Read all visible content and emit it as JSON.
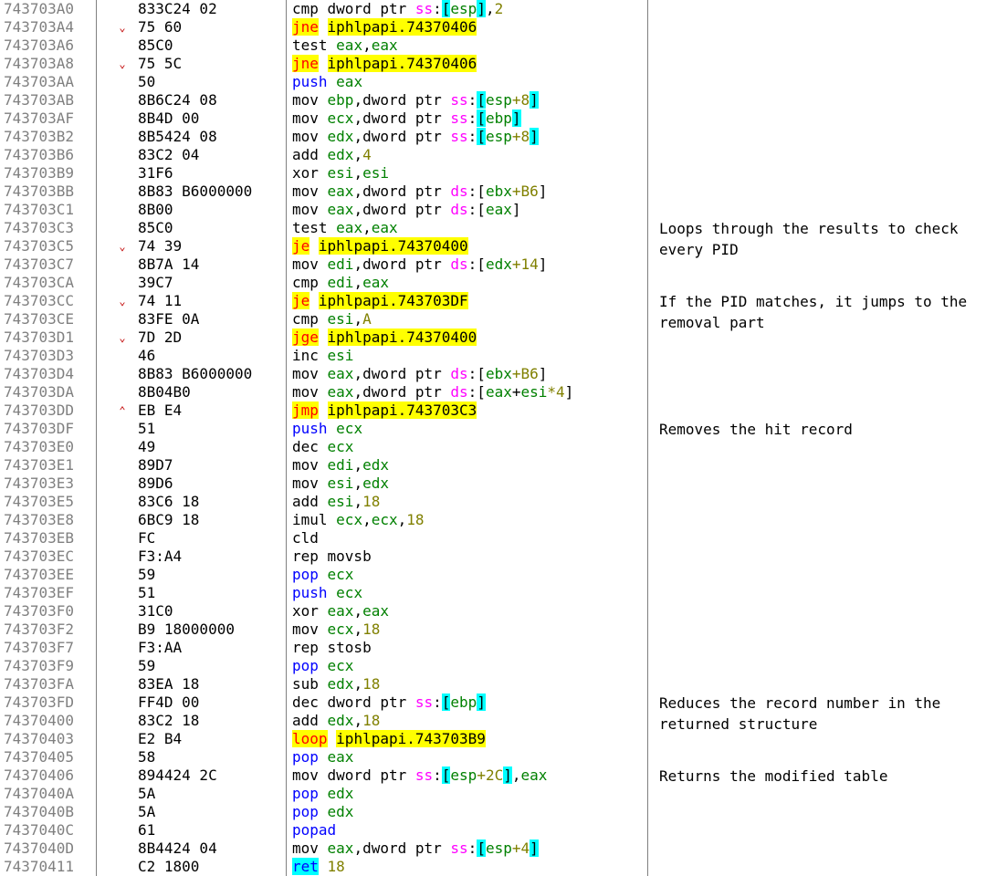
{
  "colors": {
    "address": "#808080",
    "mnemonic_jump": "#ff0000",
    "mnemonic_push_pop": "#0000ff",
    "register": "#008000",
    "number": "#808000",
    "segment": "#ff00ff",
    "highlight_jump": "#ffff00",
    "highlight_ret": "#00ffff",
    "bracket": "#00ffff"
  },
  "rows": [
    {
      "addr": "743703A0",
      "arrow": "",
      "bytes": "833C24 02",
      "tokens": [
        {
          "t": "cmp dword ptr "
        },
        {
          "t": "ss",
          "c": "seg"
        },
        {
          "t": ":"
        },
        {
          "t": "[",
          "c": "br"
        },
        {
          "t": "esp",
          "c": "reg"
        },
        {
          "t": "]",
          "c": "br"
        },
        {
          "t": ","
        },
        {
          "t": "2",
          "c": "num"
        }
      ]
    },
    {
      "addr": "743703A4",
      "arrow": "⌄",
      "bytes": "75 60",
      "tokens": [
        {
          "t": "jne",
          "c": "jmp",
          "hl": true
        },
        {
          "t": " "
        },
        {
          "t": "iphlpapi.74370406",
          "hl": true
        }
      ]
    },
    {
      "addr": "743703A6",
      "arrow": "",
      "bytes": "85C0",
      "tokens": [
        {
          "t": "test "
        },
        {
          "t": "eax",
          "c": "reg"
        },
        {
          "t": ","
        },
        {
          "t": "eax",
          "c": "reg"
        }
      ]
    },
    {
      "addr": "743703A8",
      "arrow": "⌄",
      "bytes": "75 5C",
      "tokens": [
        {
          "t": "jne",
          "c": "jmp",
          "hl": true
        },
        {
          "t": " "
        },
        {
          "t": "iphlpapi.74370406",
          "hl": true
        }
      ]
    },
    {
      "addr": "743703AA",
      "arrow": "",
      "bytes": "50",
      "tokens": [
        {
          "t": "push ",
          "c": "stk"
        },
        {
          "t": "eax",
          "c": "reg"
        }
      ]
    },
    {
      "addr": "743703AB",
      "arrow": "",
      "bytes": "8B6C24 08",
      "tokens": [
        {
          "t": "mov "
        },
        {
          "t": "ebp",
          "c": "reg"
        },
        {
          "t": ",dword ptr "
        },
        {
          "t": "ss",
          "c": "seg"
        },
        {
          "t": ":"
        },
        {
          "t": "[",
          "c": "br"
        },
        {
          "t": "esp",
          "c": "reg"
        },
        {
          "t": "+8",
          "c": "num"
        },
        {
          "t": "]",
          "c": "br"
        }
      ]
    },
    {
      "addr": "743703AF",
      "arrow": "",
      "bytes": "8B4D 00",
      "tokens": [
        {
          "t": "mov "
        },
        {
          "t": "ecx",
          "c": "reg"
        },
        {
          "t": ",dword ptr "
        },
        {
          "t": "ss",
          "c": "seg"
        },
        {
          "t": ":"
        },
        {
          "t": "[",
          "c": "br"
        },
        {
          "t": "ebp",
          "c": "reg"
        },
        {
          "t": "]",
          "c": "br"
        }
      ]
    },
    {
      "addr": "743703B2",
      "arrow": "",
      "bytes": "8B5424 08",
      "tokens": [
        {
          "t": "mov "
        },
        {
          "t": "edx",
          "c": "reg"
        },
        {
          "t": ",dword ptr "
        },
        {
          "t": "ss",
          "c": "seg"
        },
        {
          "t": ":"
        },
        {
          "t": "[",
          "c": "br"
        },
        {
          "t": "esp",
          "c": "reg"
        },
        {
          "t": "+8",
          "c": "num"
        },
        {
          "t": "]",
          "c": "br"
        }
      ]
    },
    {
      "addr": "743703B6",
      "arrow": "",
      "bytes": "83C2 04",
      "tokens": [
        {
          "t": "add "
        },
        {
          "t": "edx",
          "c": "reg"
        },
        {
          "t": ","
        },
        {
          "t": "4",
          "c": "num"
        }
      ]
    },
    {
      "addr": "743703B9",
      "arrow": "",
      "bytes": "31F6",
      "tokens": [
        {
          "t": "xor "
        },
        {
          "t": "esi",
          "c": "reg"
        },
        {
          "t": ","
        },
        {
          "t": "esi",
          "c": "reg"
        }
      ]
    },
    {
      "addr": "743703BB",
      "arrow": "",
      "bytes": "8B83 B6000000",
      "tokens": [
        {
          "t": "mov "
        },
        {
          "t": "eax",
          "c": "reg"
        },
        {
          "t": ",dword ptr "
        },
        {
          "t": "ds",
          "c": "seg"
        },
        {
          "t": ":["
        },
        {
          "t": "ebx",
          "c": "reg"
        },
        {
          "t": "+B6",
          "c": "num"
        },
        {
          "t": "]"
        }
      ]
    },
    {
      "addr": "743703C1",
      "arrow": "",
      "bytes": "8B00",
      "tokens": [
        {
          "t": "mov "
        },
        {
          "t": "eax",
          "c": "reg"
        },
        {
          "t": ",dword ptr "
        },
        {
          "t": "ds",
          "c": "seg"
        },
        {
          "t": ":["
        },
        {
          "t": "eax",
          "c": "reg"
        },
        {
          "t": "]"
        }
      ]
    },
    {
      "addr": "743703C3",
      "arrow": "",
      "bytes": "85C0",
      "tokens": [
        {
          "t": "test "
        },
        {
          "t": "eax",
          "c": "reg"
        },
        {
          "t": ","
        },
        {
          "t": "eax",
          "c": "reg"
        }
      ]
    },
    {
      "addr": "743703C5",
      "arrow": "⌄",
      "bytes": "74 39",
      "tokens": [
        {
          "t": "je",
          "c": "jmp",
          "hl": true
        },
        {
          "t": " "
        },
        {
          "t": "iphlpapi.74370400",
          "hl": true
        }
      ]
    },
    {
      "addr": "743703C7",
      "arrow": "",
      "bytes": "8B7A 14",
      "tokens": [
        {
          "t": "mov "
        },
        {
          "t": "edi",
          "c": "reg"
        },
        {
          "t": ",dword ptr "
        },
        {
          "t": "ds",
          "c": "seg"
        },
        {
          "t": ":["
        },
        {
          "t": "edx",
          "c": "reg"
        },
        {
          "t": "+14",
          "c": "num"
        },
        {
          "t": "]"
        }
      ]
    },
    {
      "addr": "743703CA",
      "arrow": "",
      "bytes": "39C7",
      "tokens": [
        {
          "t": "cmp "
        },
        {
          "t": "edi",
          "c": "reg"
        },
        {
          "t": ","
        },
        {
          "t": "eax",
          "c": "reg"
        }
      ]
    },
    {
      "addr": "743703CC",
      "arrow": "⌄",
      "bytes": "74 11",
      "tokens": [
        {
          "t": "je",
          "c": "jmp",
          "hl": true
        },
        {
          "t": " "
        },
        {
          "t": "iphlpapi.743703DF",
          "hl": true
        }
      ]
    },
    {
      "addr": "743703CE",
      "arrow": "",
      "bytes": "83FE 0A",
      "tokens": [
        {
          "t": "cmp "
        },
        {
          "t": "esi",
          "c": "reg"
        },
        {
          "t": ","
        },
        {
          "t": "A",
          "c": "num"
        }
      ]
    },
    {
      "addr": "743703D1",
      "arrow": "⌄",
      "bytes": "7D 2D",
      "tokens": [
        {
          "t": "jge",
          "c": "jmp",
          "hl": true
        },
        {
          "t": " "
        },
        {
          "t": "iphlpapi.74370400",
          "hl": true
        }
      ]
    },
    {
      "addr": "743703D3",
      "arrow": "",
      "bytes": "46",
      "tokens": [
        {
          "t": "inc "
        },
        {
          "t": "esi",
          "c": "reg"
        }
      ]
    },
    {
      "addr": "743703D4",
      "arrow": "",
      "bytes": "8B83 B6000000",
      "tokens": [
        {
          "t": "mov "
        },
        {
          "t": "eax",
          "c": "reg"
        },
        {
          "t": ",dword ptr "
        },
        {
          "t": "ds",
          "c": "seg"
        },
        {
          "t": ":["
        },
        {
          "t": "ebx",
          "c": "reg"
        },
        {
          "t": "+B6",
          "c": "num"
        },
        {
          "t": "]"
        }
      ]
    },
    {
      "addr": "743703DA",
      "arrow": "",
      "bytes": "8B04B0",
      "tokens": [
        {
          "t": "mov "
        },
        {
          "t": "eax",
          "c": "reg"
        },
        {
          "t": ",dword ptr "
        },
        {
          "t": "ds",
          "c": "seg"
        },
        {
          "t": ":["
        },
        {
          "t": "eax",
          "c": "reg"
        },
        {
          "t": "+"
        },
        {
          "t": "esi",
          "c": "reg"
        },
        {
          "t": "*4",
          "c": "num"
        },
        {
          "t": "]"
        }
      ]
    },
    {
      "addr": "743703DD",
      "arrow": "⌃",
      "bytes": "EB E4",
      "tokens": [
        {
          "t": "jmp",
          "c": "jmp",
          "hl": true
        },
        {
          "t": " "
        },
        {
          "t": "iphlpapi.743703C3",
          "hl": true
        }
      ]
    },
    {
      "addr": "743703DF",
      "arrow": "",
      "bytes": "51",
      "tokens": [
        {
          "t": "push ",
          "c": "stk"
        },
        {
          "t": "ecx",
          "c": "reg"
        }
      ]
    },
    {
      "addr": "743703E0",
      "arrow": "",
      "bytes": "49",
      "tokens": [
        {
          "t": "dec "
        },
        {
          "t": "ecx",
          "c": "reg"
        }
      ]
    },
    {
      "addr": "743703E1",
      "arrow": "",
      "bytes": "89D7",
      "tokens": [
        {
          "t": "mov "
        },
        {
          "t": "edi",
          "c": "reg"
        },
        {
          "t": ","
        },
        {
          "t": "edx",
          "c": "reg"
        }
      ]
    },
    {
      "addr": "743703E3",
      "arrow": "",
      "bytes": "89D6",
      "tokens": [
        {
          "t": "mov "
        },
        {
          "t": "esi",
          "c": "reg"
        },
        {
          "t": ","
        },
        {
          "t": "edx",
          "c": "reg"
        }
      ]
    },
    {
      "addr": "743703E5",
      "arrow": "",
      "bytes": "83C6 18",
      "tokens": [
        {
          "t": "add "
        },
        {
          "t": "esi",
          "c": "reg"
        },
        {
          "t": ","
        },
        {
          "t": "18",
          "c": "num"
        }
      ]
    },
    {
      "addr": "743703E8",
      "arrow": "",
      "bytes": "6BC9 18",
      "tokens": [
        {
          "t": "imul "
        },
        {
          "t": "ecx",
          "c": "reg"
        },
        {
          "t": ","
        },
        {
          "t": "ecx",
          "c": "reg"
        },
        {
          "t": ","
        },
        {
          "t": "18",
          "c": "num"
        }
      ]
    },
    {
      "addr": "743703EB",
      "arrow": "",
      "bytes": "FC",
      "tokens": [
        {
          "t": "cld"
        }
      ]
    },
    {
      "addr": "743703EC",
      "arrow": "",
      "bytes": "F3:A4",
      "tokens": [
        {
          "t": "rep movsb"
        }
      ]
    },
    {
      "addr": "743703EE",
      "arrow": "",
      "bytes": "59",
      "tokens": [
        {
          "t": "pop ",
          "c": "stk"
        },
        {
          "t": "ecx",
          "c": "reg"
        }
      ]
    },
    {
      "addr": "743703EF",
      "arrow": "",
      "bytes": "51",
      "tokens": [
        {
          "t": "push ",
          "c": "stk"
        },
        {
          "t": "ecx",
          "c": "reg"
        }
      ]
    },
    {
      "addr": "743703F0",
      "arrow": "",
      "bytes": "31C0",
      "tokens": [
        {
          "t": "xor "
        },
        {
          "t": "eax",
          "c": "reg"
        },
        {
          "t": ","
        },
        {
          "t": "eax",
          "c": "reg"
        }
      ]
    },
    {
      "addr": "743703F2",
      "arrow": "",
      "bytes": "B9 18000000",
      "tokens": [
        {
          "t": "mov "
        },
        {
          "t": "ecx",
          "c": "reg"
        },
        {
          "t": ","
        },
        {
          "t": "18",
          "c": "num"
        }
      ]
    },
    {
      "addr": "743703F7",
      "arrow": "",
      "bytes": "F3:AA",
      "tokens": [
        {
          "t": "rep stosb"
        }
      ]
    },
    {
      "addr": "743703F9",
      "arrow": "",
      "bytes": "59",
      "tokens": [
        {
          "t": "pop ",
          "c": "stk"
        },
        {
          "t": "ecx",
          "c": "reg"
        }
      ]
    },
    {
      "addr": "743703FA",
      "arrow": "",
      "bytes": "83EA 18",
      "tokens": [
        {
          "t": "sub "
        },
        {
          "t": "edx",
          "c": "reg"
        },
        {
          "t": ","
        },
        {
          "t": "18",
          "c": "num"
        }
      ]
    },
    {
      "addr": "743703FD",
      "arrow": "",
      "bytes": "FF4D 00",
      "tokens": [
        {
          "t": "dec dword ptr "
        },
        {
          "t": "ss",
          "c": "seg"
        },
        {
          "t": ":"
        },
        {
          "t": "[",
          "c": "br"
        },
        {
          "t": "ebp",
          "c": "reg"
        },
        {
          "t": "]",
          "c": "br"
        }
      ]
    },
    {
      "addr": "74370400",
      "arrow": "",
      "bytes": "83C2 18",
      "tokens": [
        {
          "t": "add "
        },
        {
          "t": "edx",
          "c": "reg"
        },
        {
          "t": ","
        },
        {
          "t": "18",
          "c": "num"
        }
      ]
    },
    {
      "addr": "74370403",
      "arrow": "",
      "bytes": "E2 B4",
      "tokens": [
        {
          "t": "loop",
          "c": "jmp",
          "hl": true
        },
        {
          "t": " "
        },
        {
          "t": "iphlpapi.743703B9",
          "hl": true
        }
      ]
    },
    {
      "addr": "74370405",
      "arrow": "",
      "bytes": "58",
      "tokens": [
        {
          "t": "pop ",
          "c": "stk"
        },
        {
          "t": "eax",
          "c": "reg"
        }
      ]
    },
    {
      "addr": "74370406",
      "arrow": "",
      "bytes": "894424 2C",
      "tokens": [
        {
          "t": "mov dword ptr "
        },
        {
          "t": "ss",
          "c": "seg"
        },
        {
          "t": ":"
        },
        {
          "t": "[",
          "c": "br"
        },
        {
          "t": "esp",
          "c": "reg"
        },
        {
          "t": "+2C",
          "c": "num"
        },
        {
          "t": "]",
          "c": "br"
        },
        {
          "t": ","
        },
        {
          "t": "eax",
          "c": "reg"
        }
      ]
    },
    {
      "addr": "7437040A",
      "arrow": "",
      "bytes": "5A",
      "tokens": [
        {
          "t": "pop ",
          "c": "stk"
        },
        {
          "t": "edx",
          "c": "reg"
        }
      ]
    },
    {
      "addr": "7437040B",
      "arrow": "",
      "bytes": "5A",
      "tokens": [
        {
          "t": "pop ",
          "c": "stk"
        },
        {
          "t": "edx",
          "c": "reg"
        }
      ]
    },
    {
      "addr": "7437040C",
      "arrow": "",
      "bytes": "61",
      "tokens": [
        {
          "t": "popad",
          "c": "stk"
        }
      ]
    },
    {
      "addr": "7437040D",
      "arrow": "",
      "bytes": "8B4424 04",
      "tokens": [
        {
          "t": "mov "
        },
        {
          "t": "eax",
          "c": "reg"
        },
        {
          "t": ",dword ptr "
        },
        {
          "t": "ss",
          "c": "seg"
        },
        {
          "t": ":"
        },
        {
          "t": "[",
          "c": "br"
        },
        {
          "t": "esp",
          "c": "reg"
        },
        {
          "t": "+4",
          "c": "num"
        },
        {
          "t": "]",
          "c": "br"
        }
      ]
    },
    {
      "addr": "74370411",
      "arrow": "",
      "bytes": "C2 1800",
      "tokens": [
        {
          "t": "ret",
          "c": "stk",
          "hlret": true
        },
        {
          "t": " "
        },
        {
          "t": "18",
          "c": "num"
        }
      ]
    }
  ],
  "comments": [
    {
      "row": 12,
      "text": "Loops through the results to check every PID"
    },
    {
      "row": 16,
      "text": "If the PID matches, it jumps to the removal part"
    },
    {
      "row": 23,
      "text": "Removes the hit record"
    },
    {
      "row": 38,
      "text": "Reduces the record number in the returned structure"
    },
    {
      "row": 42,
      "text": "Returns the modified table"
    }
  ]
}
